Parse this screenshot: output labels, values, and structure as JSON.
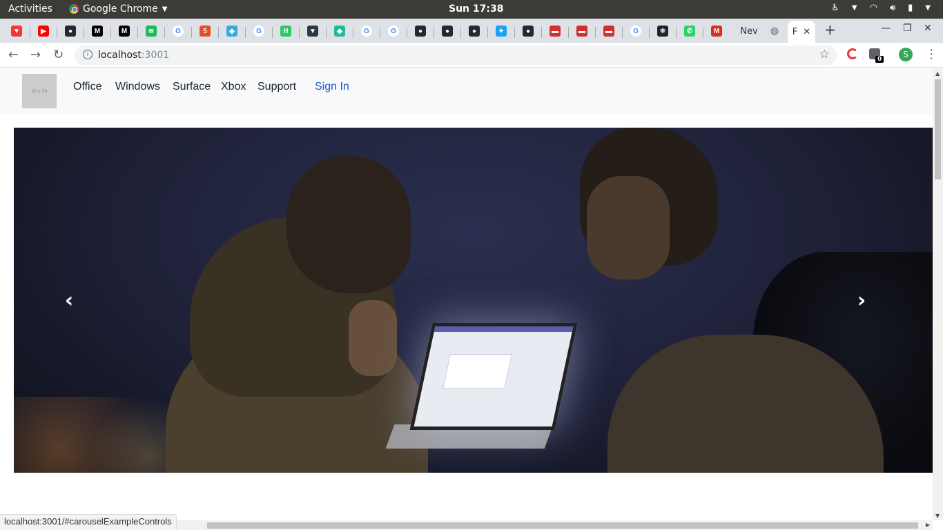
{
  "system": {
    "activities": "Activities",
    "app_name": "Google Chrome",
    "clock": "Sun 17:38"
  },
  "tabs": {
    "favicons": [
      {
        "icon": "vivaldi-icon",
        "glyph": "▼",
        "color": "#ef3939"
      },
      {
        "icon": "youtube-icon",
        "glyph": "▶",
        "color": "#ff0000"
      },
      {
        "icon": "github-icon",
        "glyph": "●",
        "color": "#24292e"
      },
      {
        "icon": "medium-icon",
        "glyph": "M",
        "color": "#000000"
      },
      {
        "icon": "medium-icon",
        "glyph": "M",
        "color": "#000000"
      },
      {
        "icon": "spotify-icon",
        "glyph": "≋",
        "color": "#1db954"
      },
      {
        "icon": "google-icon",
        "glyph": "G",
        "color": "#4285f4"
      },
      {
        "icon": "html5-icon",
        "glyph": "5",
        "color": "#e44d26"
      },
      {
        "icon": "bird-icon",
        "glyph": "◆",
        "color": "#3aa9e0"
      },
      {
        "icon": "google-icon",
        "glyph": "G",
        "color": "#4285f4"
      },
      {
        "icon": "hackerrank-icon",
        "glyph": "H",
        "color": "#2ec866"
      },
      {
        "icon": "vue-icon",
        "glyph": "▼",
        "color": "#2b3a42"
      },
      {
        "icon": "diamond-icon",
        "glyph": "◆",
        "color": "#1ebc9c"
      },
      {
        "icon": "google-icon",
        "glyph": "G",
        "color": "#4285f4"
      },
      {
        "icon": "google-icon",
        "glyph": "G",
        "color": "#4285f4"
      },
      {
        "icon": "github-icon",
        "glyph": "●",
        "color": "#24292e"
      },
      {
        "icon": "github-icon",
        "glyph": "●",
        "color": "#24292e"
      },
      {
        "icon": "github-icon",
        "glyph": "●",
        "color": "#24292e"
      },
      {
        "icon": "twitter-icon",
        "glyph": "✦",
        "color": "#1da1f2"
      },
      {
        "icon": "github-icon",
        "glyph": "●",
        "color": "#24292e"
      },
      {
        "icon": "news-icon",
        "glyph": "▬",
        "color": "#d32f2f"
      },
      {
        "icon": "news-icon",
        "glyph": "▬",
        "color": "#d32f2f"
      },
      {
        "icon": "news-icon",
        "glyph": "▬",
        "color": "#d32f2f"
      },
      {
        "icon": "google-icon",
        "glyph": "G",
        "color": "#4285f4"
      },
      {
        "icon": "react-icon",
        "glyph": "⚛",
        "color": "#20232a"
      },
      {
        "icon": "whatsapp-icon",
        "glyph": "✆",
        "color": "#25d366"
      },
      {
        "icon": "gmail-icon",
        "glyph": "M",
        "color": "#d93025"
      }
    ],
    "partial_tab_label": "Nev",
    "active_tab_label": "F"
  },
  "address_bar": {
    "host": "localhost",
    "port": ":3001",
    "extension_badge": "0",
    "profile_initial": "S"
  },
  "navbar": {
    "logo_text": "50 x 50",
    "links": [
      "Office",
      "Windows",
      "Surface",
      "Xbox",
      "Support"
    ],
    "sign_in": "Sign In"
  },
  "carousel": {
    "prev_glyph": "‹",
    "next_glyph": "›"
  },
  "status_bar": {
    "url": "localhost:3001/#carouselExampleControls"
  }
}
